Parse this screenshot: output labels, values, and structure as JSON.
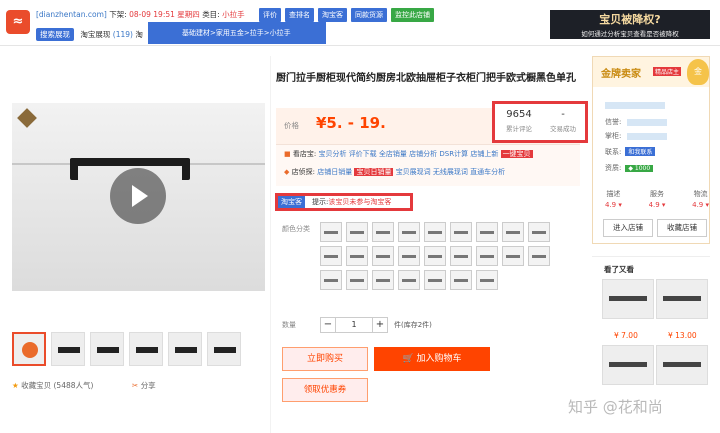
{
  "topbar": {
    "logo": "≈",
    "site": "[dianzhentan.com]",
    "listed_label": "下架:",
    "listed_date": "08-09 19:51 星期四",
    "category_label": "类目:",
    "category_value": "小拉手",
    "buttons": [
      "评价",
      "查排名",
      "淘宝客",
      "同款货源",
      "监控此店铺"
    ],
    "tag": "搜索展现",
    "tag_text": "淘宝展现",
    "tag_count": "(119)",
    "tag_suffix": "淘",
    "tooltip": "基础建材>家用五金>拉手>小拉手"
  },
  "promo": {
    "title": "宝贝被降权?",
    "sub": "如何通过分析宝贝查看是否被降权"
  },
  "product": {
    "title": "厨门拉手厨柜现代简约厨房北欧抽屉柜子衣柜门把手欧式橱黑色单孔",
    "price_label": "价格",
    "price": "¥5. - 19.",
    "reviews_count": "9654",
    "reviews_label": "累计评论",
    "sales_count": "-",
    "sales_label": "交易成功",
    "row1_label": "看店宝:",
    "row1_links": [
      "宝贝分析",
      "评价下载",
      "全店销量",
      "店铺分析",
      "DSR计算",
      "店铺上新"
    ],
    "row1_badge": "一键宝贝",
    "row2_label": "店侦探:",
    "row2_links": [
      "店铺日销量"
    ],
    "row2_badge": "宝贝日销量",
    "row2_links2": [
      "宝贝展现词",
      "无线展现词",
      "直通车分析"
    ],
    "taoke_tag": "淘宝客",
    "taoke_prefix": "提示:",
    "taoke_msg": "该宝贝未参与淘宝客",
    "color_label": "颜色分类",
    "qty_label": "数量",
    "qty_minus": "−",
    "qty_value": "1",
    "qty_plus": "+",
    "qty_unit": "件(库存2件)",
    "buy_now": "立即购买",
    "add_cart": "加入购物车",
    "cart_icon": "🛒",
    "coupon": "领取优惠券",
    "favorite": "收藏宝贝 (5488人气)",
    "share": "分享"
  },
  "seller": {
    "gold_label": "金牌卖家",
    "level": "精品店主",
    "medal": "金",
    "credit_label": "信誉:",
    "shop_label": "掌柜:",
    "contact_label": "联系:",
    "contact_btn": "和我联系",
    "qual_label": "资质:",
    "qual_badge": "◆ 1000",
    "score_labels": [
      "描述",
      "服务",
      "物流"
    ],
    "score_values": [
      "4.9 ▾",
      "4.9 ▾",
      "4.9 ▾"
    ],
    "enter_shop": "进入店铺",
    "fav_shop": "收藏店铺"
  },
  "look": {
    "title": "看了又看",
    "prices": [
      "¥ 7.00",
      "¥ 13.00"
    ]
  },
  "watermark": "知乎 @花和尚",
  "colors": {
    "accent": "#ff4400",
    "brand_blue": "#3b6fd5",
    "alert_red": "#e4393c"
  }
}
